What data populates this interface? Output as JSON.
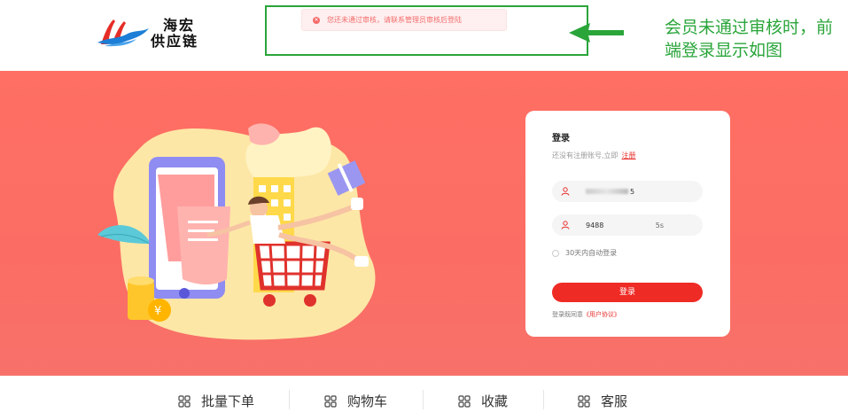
{
  "header": {
    "logo_line1": "海宏",
    "logo_line2": "供应链"
  },
  "error_message": "您还未通过审核，请联系管理员审核后登陆",
  "annotation_note": "会员未通过审核时，前端登录显示如图",
  "login": {
    "title": "登录",
    "no_account_text": "还没有注册账号,立即",
    "register_link": "注册",
    "username_suffix": "5",
    "password_value": "9488",
    "countdown": "5s",
    "remember_label": "30天内自动登录",
    "login_button": "登录",
    "agreement_prefix": "登录既同意",
    "agreement_link": "《用户协议》"
  },
  "bottom_nav": [
    {
      "label": "批量下单",
      "icon": "grid-icon"
    },
    {
      "label": "购物车",
      "icon": "grid-icon"
    },
    {
      "label": "收藏",
      "icon": "grid-icon"
    },
    {
      "label": "客服",
      "icon": "grid-icon"
    }
  ],
  "colors": {
    "banner": "#fb6d64",
    "primary_red": "#ef2b26",
    "annotation_green": "#2aa53a",
    "error_red": "#f56c6c"
  }
}
